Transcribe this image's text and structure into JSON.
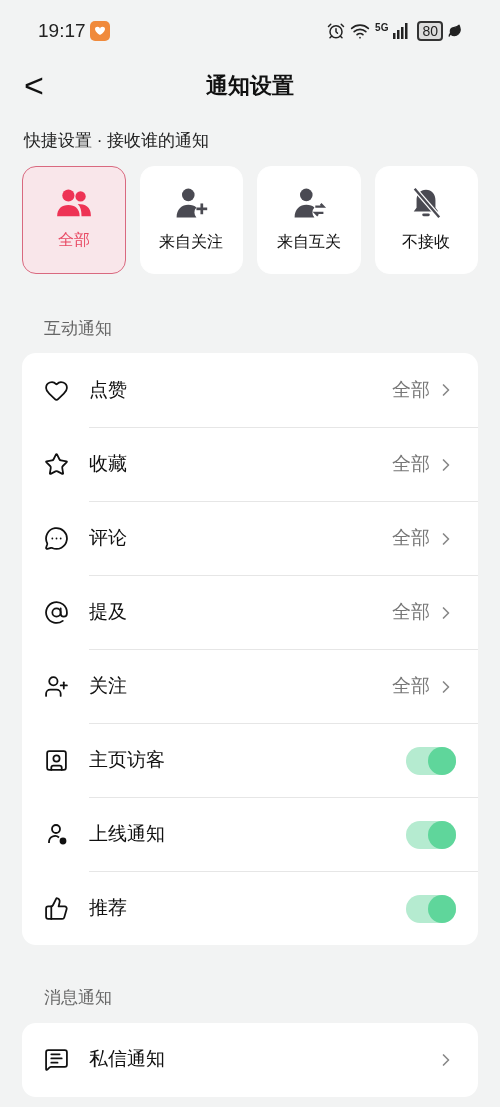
{
  "status_bar": {
    "time": "19:17",
    "network": "5G",
    "battery": "80"
  },
  "header": {
    "back": "<",
    "title": "通知设置"
  },
  "quick_settings": {
    "label": "快捷设置 · 接收谁的通知",
    "options": [
      {
        "label": "全部",
        "selected": true
      },
      {
        "label": "来自关注",
        "selected": false
      },
      {
        "label": "来自互关",
        "selected": false
      },
      {
        "label": "不接收",
        "selected": false
      }
    ]
  },
  "sections": [
    {
      "title": "互动通知",
      "rows": [
        {
          "label": "点赞",
          "kind": "link",
          "value": "全部"
        },
        {
          "label": "收藏",
          "kind": "link",
          "value": "全部"
        },
        {
          "label": "评论",
          "kind": "link",
          "value": "全部"
        },
        {
          "label": "提及",
          "kind": "link",
          "value": "全部"
        },
        {
          "label": "关注",
          "kind": "link",
          "value": "全部"
        },
        {
          "label": "主页访客",
          "kind": "toggle",
          "on": true
        },
        {
          "label": "上线通知",
          "kind": "toggle",
          "on": true
        },
        {
          "label": "推荐",
          "kind": "toggle",
          "on": true
        }
      ]
    },
    {
      "title": "消息通知",
      "rows": [
        {
          "label": "私信通知",
          "kind": "link"
        }
      ]
    }
  ]
}
